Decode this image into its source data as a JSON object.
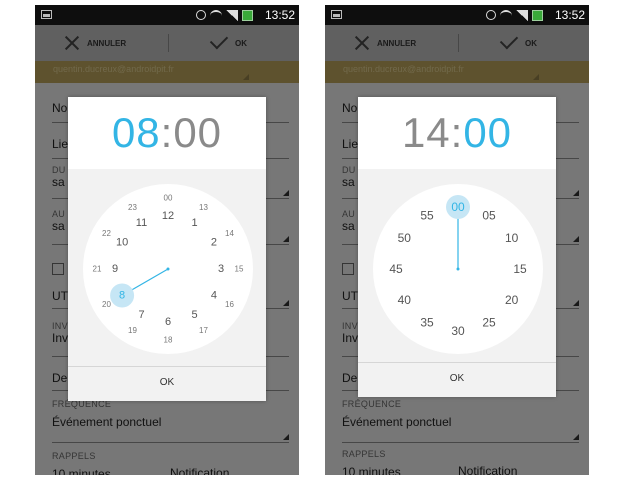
{
  "colors": {
    "accent": "#33b5e5",
    "selected_bg": "#c6e6f5"
  },
  "phones": [
    {
      "id": "left",
      "statusbar": {
        "time": "13:52"
      },
      "actionbar": {
        "cancel_label": "ANNULER",
        "ok_label": "OK"
      },
      "account_email": "quentin.ducreux@androidpit.fr",
      "bg_form": {
        "name_label": "No",
        "location_label": "Lie",
        "duration_label": "DU",
        "duration_value": "sa",
        "availability_label": "AU",
        "availability_value": "sa",
        "timezone_value": "UT",
        "invite_label": "INV",
        "invite_value": "Inv",
        "description_label": "De",
        "repeat_label": "FRÉQUENCE",
        "repeat_value": "Événement ponctuel",
        "reminders_label": "RAPPELS",
        "reminder_time": "10 minutes",
        "reminder_type": "Notification"
      },
      "dialog": {
        "time_hours": "08",
        "time_sep": ":",
        "time_minutes": "00",
        "active_part": "hours",
        "ok_label": "OK",
        "mode": "hours",
        "outer_labels": [
          "12",
          "1",
          "2",
          "3",
          "4",
          "5",
          "6",
          "7",
          "8",
          "9",
          "10",
          "11"
        ],
        "inner_labels": [
          "00",
          "13",
          "14",
          "15",
          "16",
          "17",
          "18",
          "19",
          "20",
          "21",
          "22",
          "23"
        ],
        "selected_label": "8"
      }
    },
    {
      "id": "right",
      "statusbar": {
        "time": "13:52"
      },
      "actionbar": {
        "cancel_label": "ANNULER",
        "ok_label": "OK"
      },
      "account_email": "quentin.ducreux@androidpit.fr",
      "bg_form": {
        "name_label": "No",
        "location_label": "Lie",
        "duration_label": "DU",
        "duration_value": "sa",
        "availability_label": "AU",
        "availability_value": "sa",
        "timezone_value": "UT",
        "invite_label": "INV",
        "invite_value": "Inv",
        "description_label": "De",
        "repeat_label": "FRÉQUENCE",
        "repeat_value": "Événement ponctuel",
        "reminders_label": "RAPPELS",
        "reminder_time": "10 minutes",
        "reminder_type": "Notification"
      },
      "dialog": {
        "time_hours": "14",
        "time_sep": ":",
        "time_minutes": "00",
        "active_part": "minutes",
        "ok_label": "OK",
        "mode": "minutes",
        "outer_labels": [
          "00",
          "05",
          "10",
          "15",
          "20",
          "25",
          "30",
          "35",
          "40",
          "45",
          "50",
          "55"
        ],
        "selected_label": "00"
      }
    }
  ]
}
